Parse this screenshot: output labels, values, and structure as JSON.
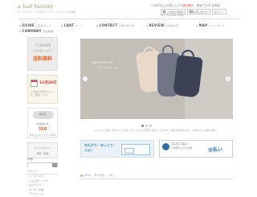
{
  "header": {
    "logo": "a leaf factory",
    "tagline": "トートバッグ・ショルダーバッグ・エコバッグの通販",
    "announce_prefix": "7,560円以上お買い上げで",
    "announce_highlight": "送料無料",
    "announce_suffix": "！ 単品でもOK 全商品",
    "utility": [
      {
        "label": "ご注文状況確認",
        "icon": "cart-icon"
      },
      {
        "label": "お問い合わせ",
        "icon": "mail-icon"
      },
      {
        "label": "ログイン"
      }
    ],
    "contact_line": "TEL: 03-0000-0000"
  },
  "nav": [
    {
      "label": "GUIDE",
      "sub": "ご利用ガイド"
    },
    {
      "label": "CART",
      "sub": "カート"
    },
    {
      "label": "CONTACT",
      "sub": "お問い合わせ"
    },
    {
      "label": "REVIEW",
      "sub": "お客様の声"
    },
    {
      "label": "MAP",
      "sub": "サイトマップ"
    },
    {
      "label": "COMPANY",
      "sub": "会社概要"
    }
  ],
  "sidebar": {
    "banner1": {
      "price": "7,560円",
      "sub": "以上お買い上げで",
      "big": "送料無料"
    },
    "banner2": {
      "red": "11月28日",
      "text": "ご注文はお早めにどうぞ。発送について"
    },
    "banner3": {
      "line1": "再販売",
      "line2": "お客様の声",
      "highlight": "300",
      "line3": "件以上いただいています"
    },
    "banner4": {
      "line1": "メールマガジン",
      "line2": "登録・解除"
    },
    "search_label": "検索",
    "search_placeholder": "",
    "category_head": "カテゴリー",
    "categories": [
      "トートバッグ",
      "ショルダーバッグ",
      "エコバッグ",
      "ポーチ・小物",
      "アウトレット",
      "新着アイテム"
    ]
  },
  "hero": {
    "title": "ANOTHER LEAF",
    "subtitle": "ナチュラルなバッグ"
  },
  "intro": "シンプルで使いやすいバッグを、ひとつひとつ丁寧に仕立てています。毎日のお出かけに、大切な人への贈り物に。",
  "banner_left": {
    "head": "のんびり・ゆっくり",
    "sub": "お届け"
  },
  "banner_right": {
    "line1": "コンビニ払い",
    "line2": "ご利用いただけます",
    "pay": "@払い"
  },
  "section": {
    "label": "NEW",
    "title": "アイテム",
    "count": "一覧"
  }
}
